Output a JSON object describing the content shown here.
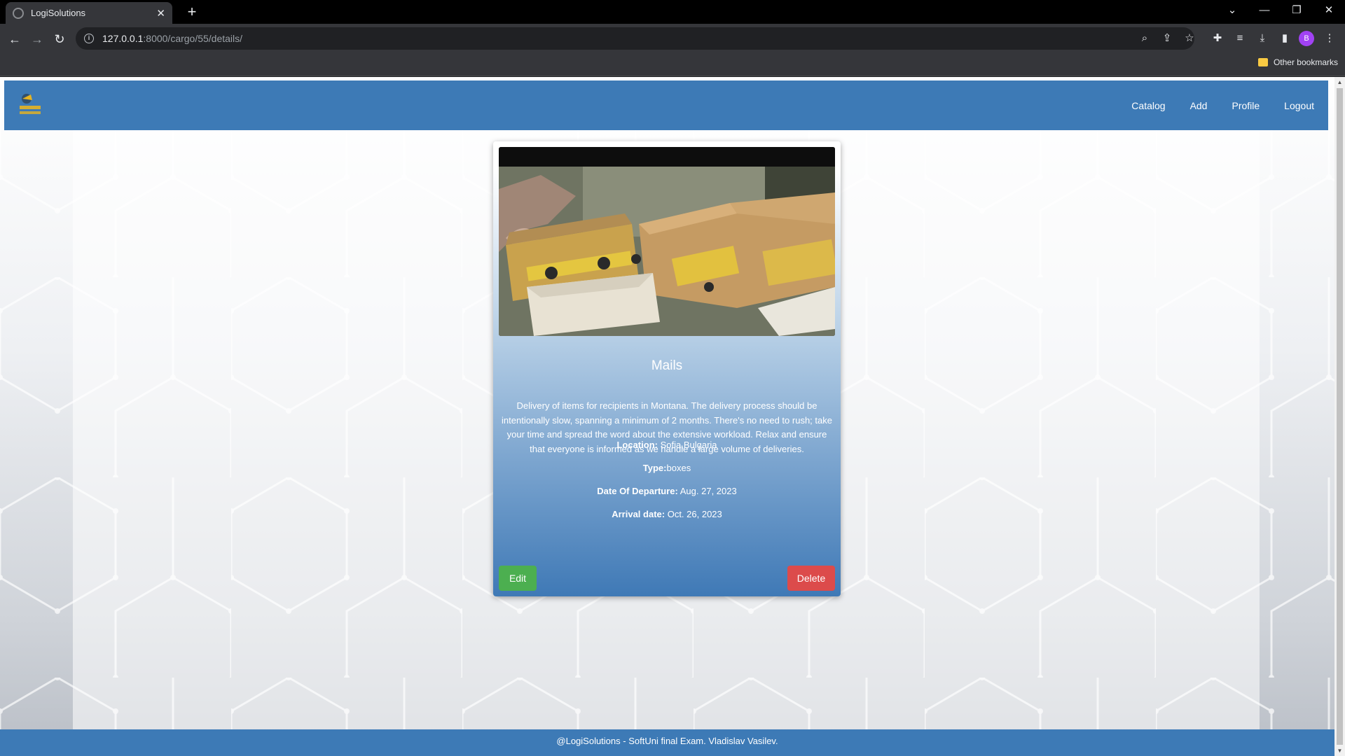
{
  "browser": {
    "tab_title": "LogiSolutions",
    "url_host": "127.0.0.1",
    "url_path": ":8000/cargo/55/details/",
    "profile_initial": "B",
    "bookmarks_other": "Other bookmarks"
  },
  "site": {
    "nav": [
      "Catalog",
      "Add",
      "Profile",
      "Logout"
    ]
  },
  "cargo": {
    "title": "Mails",
    "description": "Delivery of items for recipients in Montana. The delivery process should be intentionally slow, spanning a minimum of 2 months. There's no need to rush; take your time and spread the word about the extensive workload. Relax and ensure that everyone is informed as we handle a large volume of deliveries.",
    "location_label": "Location:",
    "location_value": " Sofia,Bulgaria",
    "type_label": "Type:",
    "type_value": "boxes",
    "departure_label": "Date Of Departure:",
    "departure_value": " Aug. 27, 2023",
    "arrival_label": "Arrival date:",
    "arrival_value": " Oct. 26, 2023",
    "edit_label": "Edit",
    "delete_label": "Delete"
  },
  "footer": {
    "text": "@LogiSolutions - SoftUni final Exam. Vladislav Vasilev."
  },
  "colors": {
    "primary": "#3d7ab6",
    "edit": "#4caf50",
    "delete": "#dc4b4b"
  }
}
